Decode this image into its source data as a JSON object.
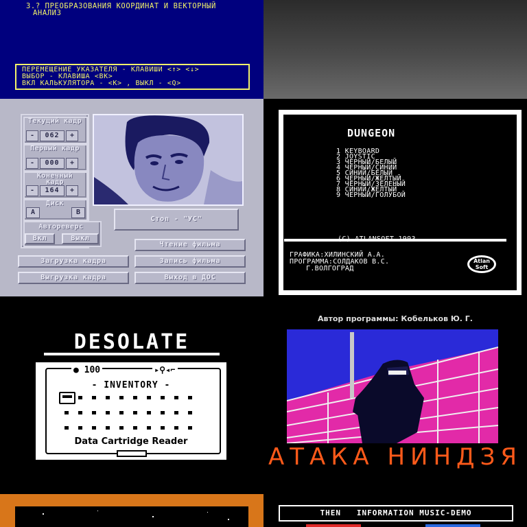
{
  "tile1": {
    "lines": [
      "3.? ПРЕОБРАЗОВАНИЯ КООРДИНАТ И ВЕКТОРНЫЙ",
      "АНАЛИЗ"
    ],
    "box_lines": [
      "ПЕРЕМЕЩЕНИЕ УКАЗАТЕЛЯ - КЛАВИШИ <↑> <↓>",
      "ВЫБОР - КЛАВИША <ВК>",
      "ВКЛ КАЛЬКУЛЯТОРА - <К> , ВЫКЛ - <Q>"
    ],
    "colors": {
      "bg": "#00007e",
      "text": "#f3f36a"
    }
  },
  "tile3": {
    "current_frame_label": "Текущий кадр",
    "current_frame_value": "062",
    "first_frame_label": "Первый кадр",
    "first_frame_value": "000",
    "last_frame_label": "Конечный кадр",
    "last_frame_value": "164",
    "minus": "-",
    "plus": "+",
    "disk_label": "Диск",
    "disk_a": "A",
    "disk_b": "B",
    "autoreverse_label": "Автореверс",
    "on_label": "Вкл",
    "off_label": "Выкл",
    "status": "Стоп - \"УС\"",
    "read_film": "Чтение фильма",
    "load_frame": "Загрузка кадра",
    "write_film": "Запись фильма",
    "unload_frame": "Выгрузка кадра",
    "exit_dos": "Выход в ДОС"
  },
  "tile4": {
    "title": "DUNGEON",
    "menu": [
      "1 KEYBOARD",
      "2 JOYSTIC",
      "3 ЧЕРНЫЙ/БЕЛЫЙ",
      "4 ЧЕРНЫЙ/СИНИЙ",
      "5 СИНИЙ/БЕЛЫЙ",
      "6 ЧЕРНЫЙ/ЖЕЛТЫЙ",
      "7 ЧЕРНЫЙ/ЗЕЛЕНЫЙ",
      "8 СИНИЙ/ЖЕЛТЫЙ",
      "9 ЧЕРНЫЙ/ГОЛУБОЙ"
    ],
    "copyright": "(C) ATLANSOFT 1993",
    "credits": [
      "ГРАФИКА:ХИЛИНСКИЙ А.А.",
      "ПРОГРАММА:СОЛДАКОВ В.С.",
      "Г.ВОЛГОГРАД"
    ],
    "logo_text": "Atlan Soft"
  },
  "tile5": {
    "title": "DESOLATE",
    "coins": "100",
    "inventory_label": "- INVENTORY -",
    "item_name": "Data Cartridge Reader"
  },
  "tile6": {
    "author": "Автор программы: Кобельков Ю. Г.",
    "title": "АТАКА НИНДЗЯ"
  },
  "tile8": {
    "bar_text": "THEN   INFORMATION MUSIC-DEMO"
  }
}
